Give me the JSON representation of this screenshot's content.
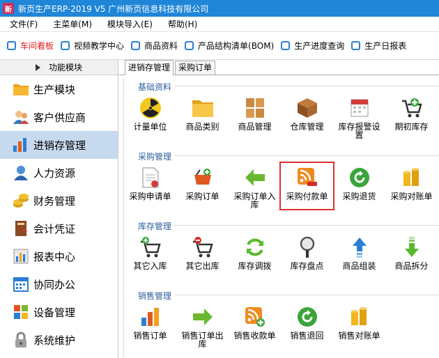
{
  "titlebar": {
    "icon_text": "新",
    "title": "新页生产ERP-2019 V5 广州新页信息科技有限公司"
  },
  "menu": [
    "文件(F)",
    "主菜单(M)",
    "模块导入(E)",
    "帮助(H)"
  ],
  "toolbar": [
    {
      "label": "车间看板",
      "active": true
    },
    {
      "label": "视频教学中心",
      "active": false
    },
    {
      "label": "商品资料",
      "active": false
    },
    {
      "label": "产品结构清单(BOM)",
      "active": false
    },
    {
      "label": "生产进度查询",
      "active": false
    },
    {
      "label": "生产日报表",
      "active": false
    }
  ],
  "sidebar": {
    "header": "功能模块",
    "items": [
      {
        "label": "生产模块",
        "icon": "folder-icon"
      },
      {
        "label": "客户供应商",
        "icon": "people-icon"
      },
      {
        "label": "进销存管理",
        "icon": "bar-chart-icon",
        "selected": true
      },
      {
        "label": "人力资源",
        "icon": "person-icon"
      },
      {
        "label": "财务管理",
        "icon": "coins-icon"
      },
      {
        "label": "会计凭证",
        "icon": "book-icon"
      },
      {
        "label": "报表中心",
        "icon": "report-icon"
      },
      {
        "label": "协同办公",
        "icon": "calendar-icon"
      },
      {
        "label": "设备管理",
        "icon": "window-icon"
      },
      {
        "label": "系统维护",
        "icon": "lock-icon"
      }
    ]
  },
  "tabs": [
    "进销存管理",
    "采购订单"
  ],
  "groups": [
    {
      "title": "基础资料",
      "items": [
        {
          "label": "计量单位",
          "icon": "radiation-icon"
        },
        {
          "label": "商品类别",
          "icon": "folder-icon"
        },
        {
          "label": "商品管理",
          "icon": "boxes-icon"
        },
        {
          "label": "仓库管理",
          "icon": "warehouse-icon"
        },
        {
          "label": "库存报警设置",
          "icon": "calendar-alert-icon"
        },
        {
          "label": "期初库存",
          "icon": "cart-add-icon"
        }
      ]
    },
    {
      "title": "采购管理",
      "items": [
        {
          "label": "采购申请单",
          "icon": "document-icon"
        },
        {
          "label": "采购订单",
          "icon": "basket-icon"
        },
        {
          "label": "采购订单入库",
          "icon": "arrow-left-icon"
        },
        {
          "label": "采购付款单",
          "icon": "rss-minus-icon",
          "highlight": true
        },
        {
          "label": "采购退货",
          "icon": "return-icon"
        },
        {
          "label": "采购对账单",
          "icon": "coin-stack-icon"
        }
      ]
    },
    {
      "title": "库存管理",
      "items": [
        {
          "label": "其它入库",
          "icon": "cart-add-icon"
        },
        {
          "label": "其它出库",
          "icon": "cart-remove-icon"
        },
        {
          "label": "库存调拨",
          "icon": "refresh-icon"
        },
        {
          "label": "库存盘点",
          "icon": "magnifier-icon"
        },
        {
          "label": "商品组装",
          "icon": "arrow-up-icon"
        },
        {
          "label": "商品拆分",
          "icon": "arrow-down-icon"
        }
      ]
    },
    {
      "title": "销售管理",
      "items": [
        {
          "label": "销售订单",
          "icon": "bar-chart-icon"
        },
        {
          "label": "销售订单出库",
          "icon": "arrow-right-icon"
        },
        {
          "label": "销售收款单",
          "icon": "rss-plus-icon"
        },
        {
          "label": "销售退回",
          "icon": "return-icon"
        },
        {
          "label": "销售对账单",
          "icon": "coin-stack-icon"
        }
      ]
    }
  ],
  "colors": {
    "titlebar": "#1f86d8",
    "selected": "#c6d9ef",
    "group_title": "#2d5e9e",
    "highlight": "#e03030",
    "active_toolbar": "#e02020"
  }
}
